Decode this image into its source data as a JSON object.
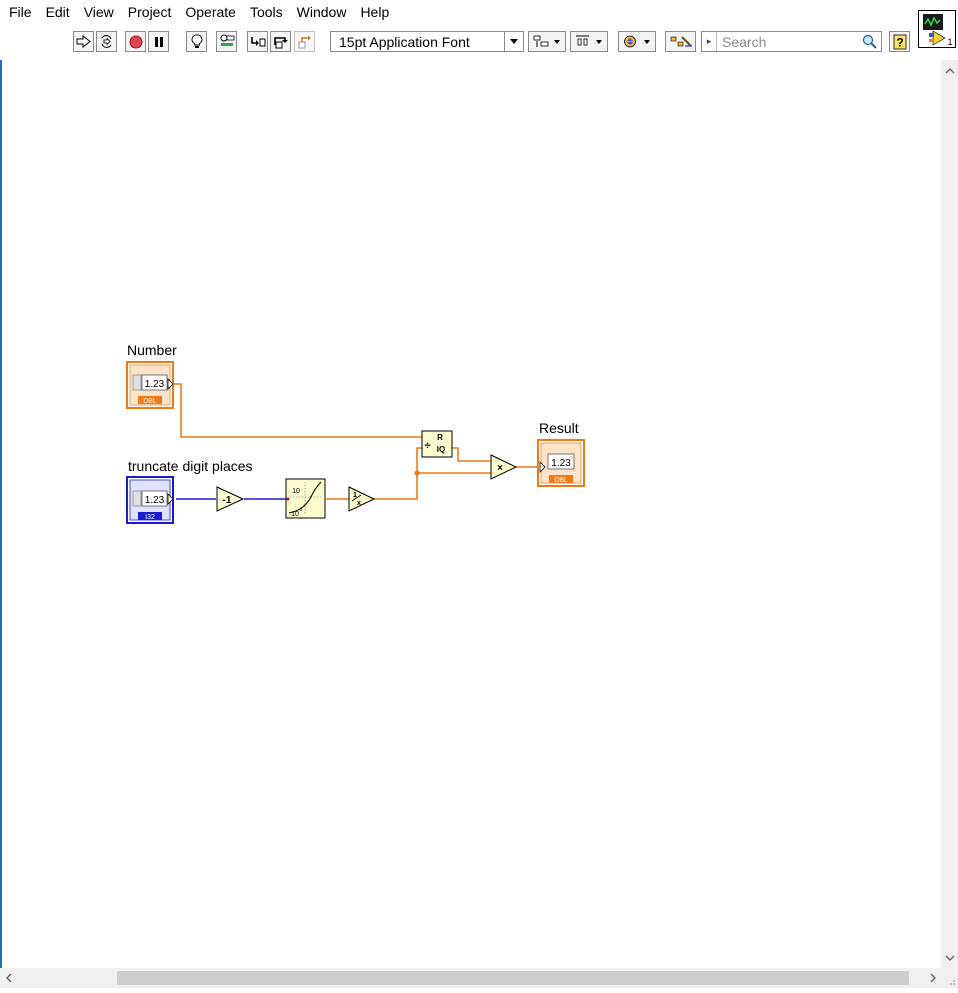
{
  "menu": [
    "File",
    "Edit",
    "View",
    "Project",
    "Operate",
    "Tools",
    "Window",
    "Help"
  ],
  "toolbar": {
    "font_selector": "15pt Application Font",
    "search_placeholder": "Search"
  },
  "diagram": {
    "labels": {
      "number": "Number",
      "truncate": "truncate digit places",
      "result": "Result"
    },
    "terminals": {
      "number_value": "1.23",
      "number_type": "DBL",
      "truncate_value": "1.23",
      "truncate_type": "I32",
      "result_value": "1.23",
      "result_type": "DBL"
    },
    "nodes": {
      "decrement": "-1",
      "power_top": "10",
      "power_base": "10",
      "power_exp": "x",
      "reciprocal_num": "1",
      "reciprocal_den": "x",
      "quotient_top": "R",
      "quotient_bottom": "IQ",
      "multiply": "×"
    }
  },
  "vi_icon": {
    "number": "1"
  },
  "colors": {
    "dbl_wire": "#f07a18",
    "i32_wire": "#1b1bd6",
    "node_fill": "#fcfcd0",
    "canvas_edge": "#1e6fd1"
  }
}
